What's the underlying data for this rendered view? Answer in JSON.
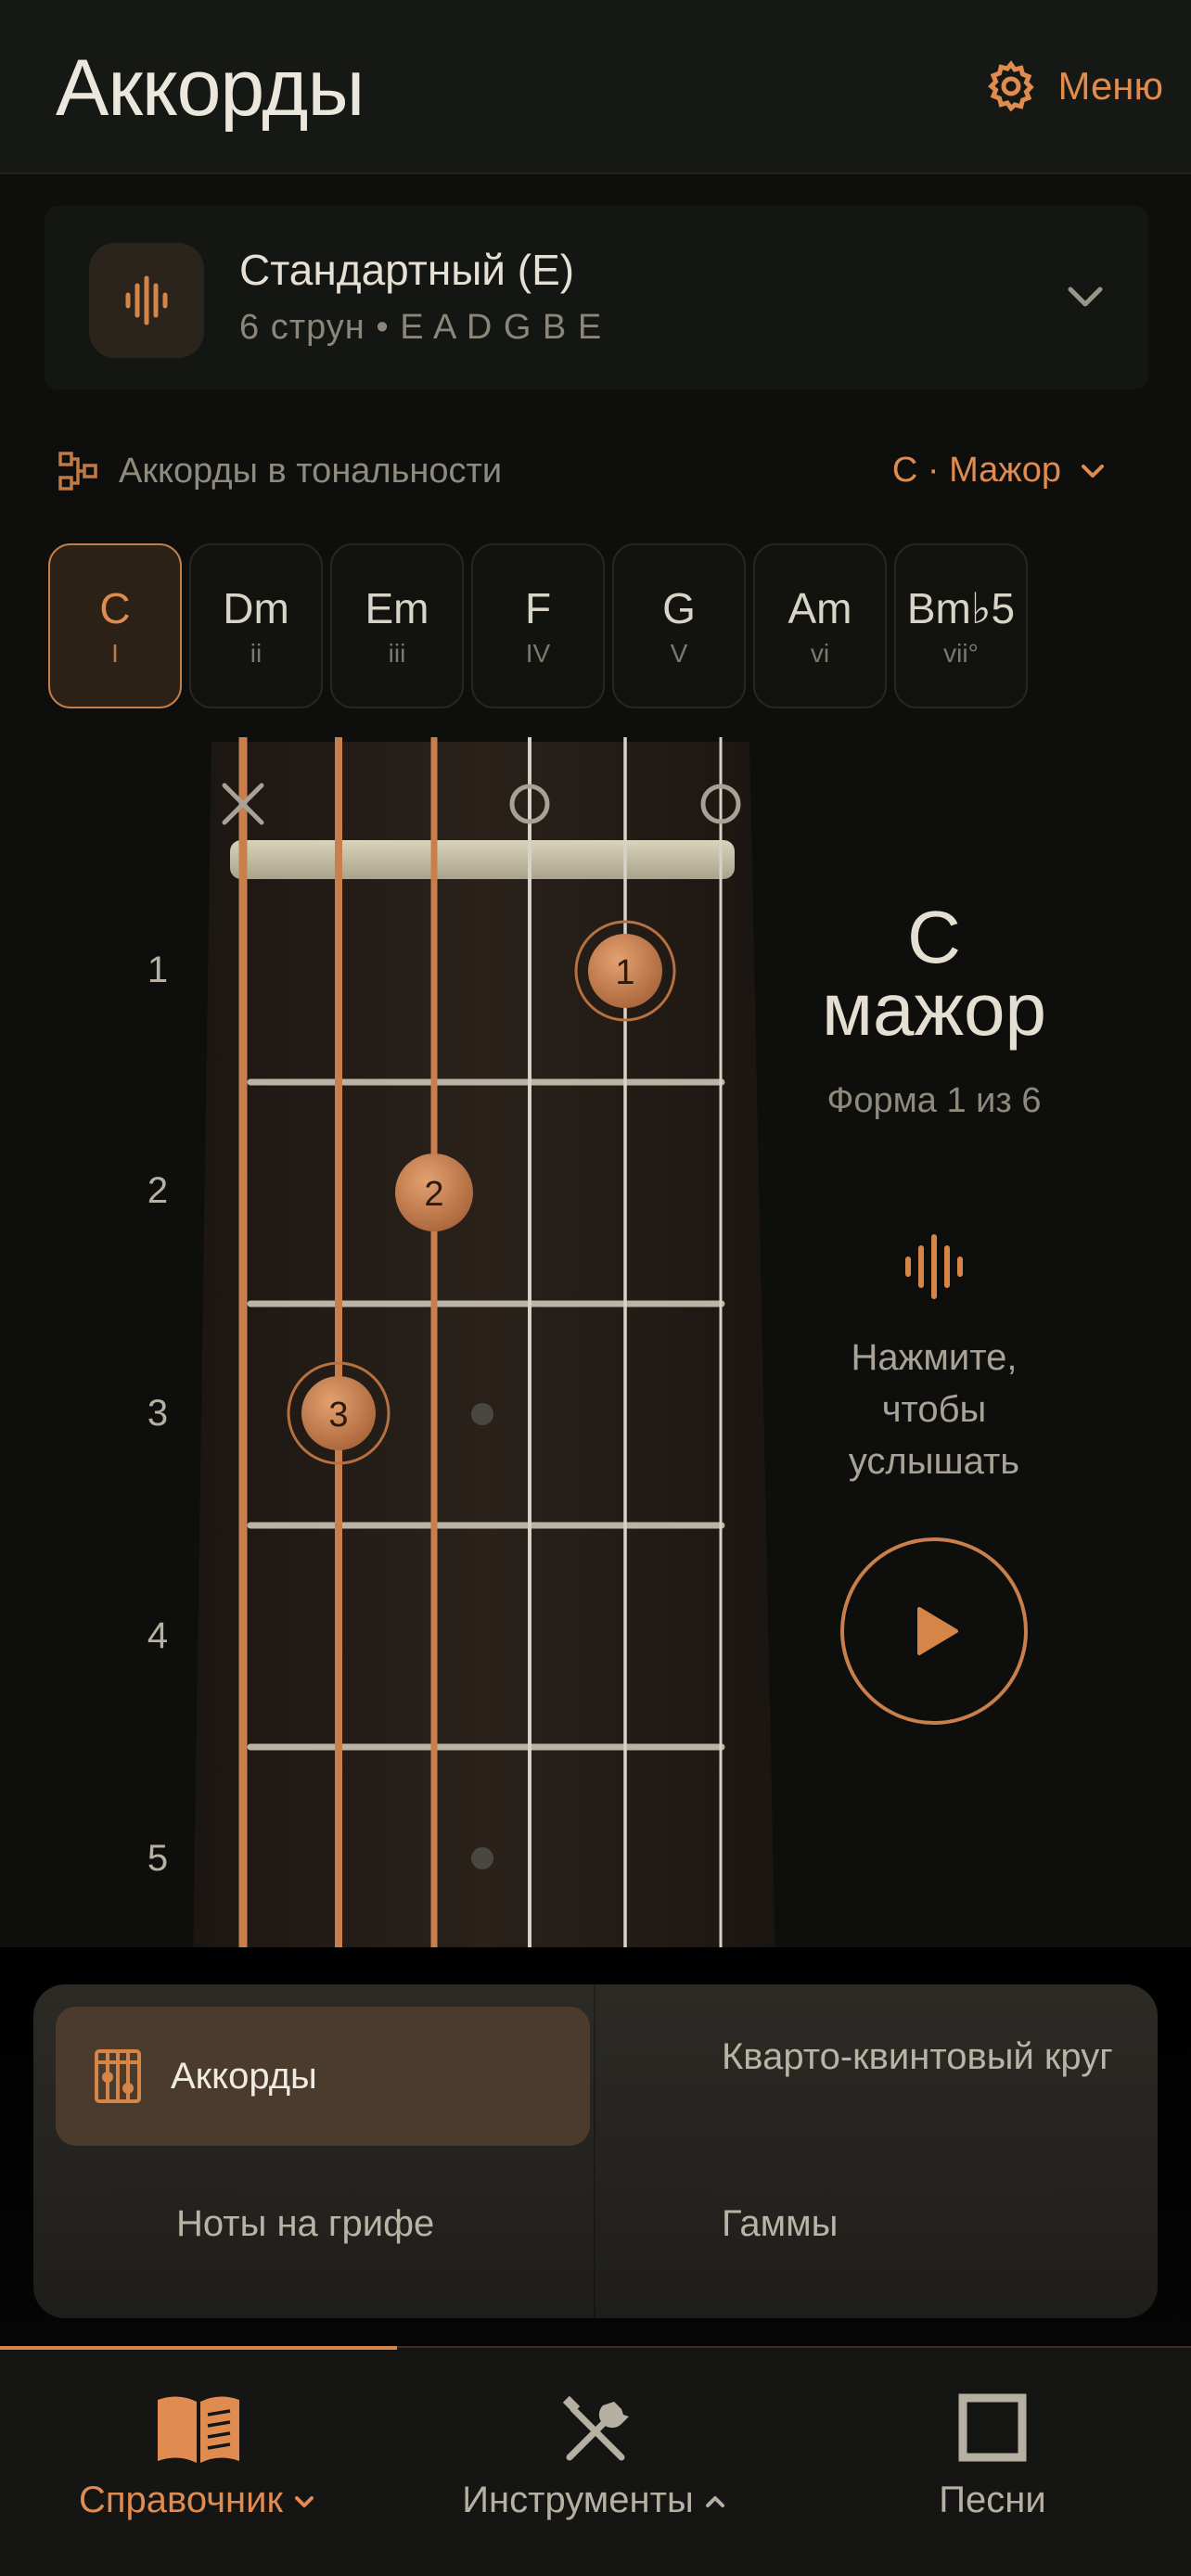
{
  "header": {
    "title": "Аккорды",
    "menu_label": "Меню"
  },
  "tuning": {
    "name": "Стандартный (E)",
    "strings": "6 струн  •  E A D G B E"
  },
  "key_row": {
    "label": "Аккорды в тональности",
    "selected_key": "C · Мажор"
  },
  "chords": [
    {
      "name": "C",
      "degree": "I",
      "active": true
    },
    {
      "name": "Dm",
      "degree": "ii",
      "active": false
    },
    {
      "name": "Em",
      "degree": "iii",
      "active": false
    },
    {
      "name": "F",
      "degree": "IV",
      "active": false
    },
    {
      "name": "G",
      "degree": "V",
      "active": false
    },
    {
      "name": "Am",
      "degree": "vi",
      "active": false
    },
    {
      "name": "Bm♭5",
      "degree": "vii°",
      "active": false
    }
  ],
  "fret_numbers": [
    "1",
    "2",
    "3",
    "4",
    "5"
  ],
  "fretboard": {
    "open_markers": [
      "x",
      "",
      "",
      "o",
      "",
      "o"
    ],
    "fingers": [
      {
        "string": 5,
        "fret": 1,
        "finger": "1"
      },
      {
        "string": 3,
        "fret": 2,
        "finger": "2"
      },
      {
        "string": 2,
        "fret": 3,
        "finger": "3"
      }
    ],
    "inlay_frets": [
      3,
      5
    ]
  },
  "chord_info": {
    "title_line1": "C",
    "title_line2": "мажор",
    "shape": "Форма 1 из 6",
    "listen_text": "Нажмите, чтобы услышать"
  },
  "tools_popup": {
    "items": [
      "Аккорды",
      "Кварто-квинтовый круг",
      "Ноты на грифе",
      "Гаммы"
    ],
    "active": "Аккорды"
  },
  "tabs": [
    {
      "label": "Справочник",
      "active": true,
      "icon": "book-icon"
    },
    {
      "label": "Инструменты",
      "active": false,
      "icon": "tools-icon"
    },
    {
      "label": "Песни",
      "active": false,
      "icon": "square-icon"
    }
  ],
  "colors": {
    "accent": "#e08b4f",
    "background": "#0e0f0d"
  }
}
